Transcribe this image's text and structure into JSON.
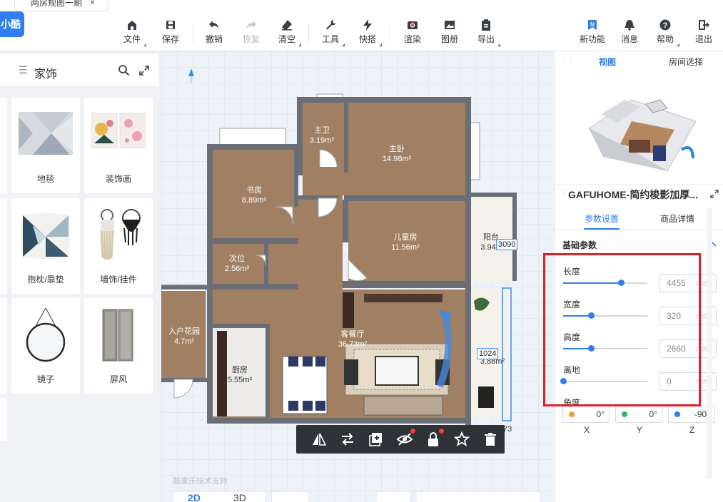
{
  "app": {
    "tab_title": "两房规图一期",
    "tab_close": "×",
    "logo_text": "小酷",
    "accent_color": "#2f7dee"
  },
  "toolbar": {
    "file": "文件",
    "save": "保存",
    "undo": "撤销",
    "redo": "恢复",
    "clear": "清空",
    "tools": "工具",
    "quick": "快搭",
    "render": "渲染",
    "album": "图册",
    "export": "导出",
    "new_features": "新功能",
    "messages": "消息",
    "help": "帮助",
    "exit": "退出"
  },
  "left_panel": {
    "category_title": "家饰",
    "items": [
      {
        "label": "地毯"
      },
      {
        "label": "装饰画"
      },
      {
        "label": "抱枕/靠垫"
      },
      {
        "label": "墙饰/挂件"
      },
      {
        "label": "镜子"
      },
      {
        "label": "屏风"
      }
    ]
  },
  "floorplan": {
    "rooms": [
      {
        "name": "主卫",
        "area": "3.19m²"
      },
      {
        "name": "主卧",
        "area": "14.98m²"
      },
      {
        "name": "书房",
        "area": "8.89m²"
      },
      {
        "name": "儿童房",
        "area": "11.56m²"
      },
      {
        "name": "阳台",
        "area": "3.94"
      },
      {
        "name": "次位",
        "area": "2.56m²"
      },
      {
        "name": "入户花园",
        "area": "4.7m²"
      },
      {
        "name": "客餐厅",
        "area": "36.73m²"
      },
      {
        "name": "厨房",
        "area": "5.55m²"
      },
      {
        "name": "",
        "area": "3.88m²"
      }
    ],
    "dimension_top": "3090",
    "dimension_side": "1024",
    "dimension_bottom": "73",
    "watermark": "酷家乐技术支持"
  },
  "bottom_tabs": {
    "mode_2d": "2D",
    "mode_3d": "3D"
  },
  "right_panel": {
    "view_tabs": {
      "view": "视图",
      "room_select": "房间选择"
    },
    "product_title": "GAFUHOME-简约梭影加厚...",
    "sub_tabs": {
      "params": "参数设置",
      "details": "商品详情"
    },
    "section": "基础参数",
    "unit": "mm",
    "params": [
      {
        "label": "长度",
        "value": "4455",
        "fraction": 0.69
      },
      {
        "label": "宽度",
        "value": "320",
        "fraction": 0.33
      },
      {
        "label": "高度",
        "value": "2660",
        "fraction": 0.33
      },
      {
        "label": "离地",
        "value": "0",
        "fraction": 0.0
      }
    ],
    "angle_label": "角度",
    "angles": [
      {
        "axis": "X",
        "value": "0°",
        "color": "#f0a020"
      },
      {
        "axis": "Y",
        "value": "0°",
        "color": "#2fb56a"
      },
      {
        "axis": "Z",
        "value": "-90°",
        "color": "#2f7dee"
      }
    ]
  }
}
